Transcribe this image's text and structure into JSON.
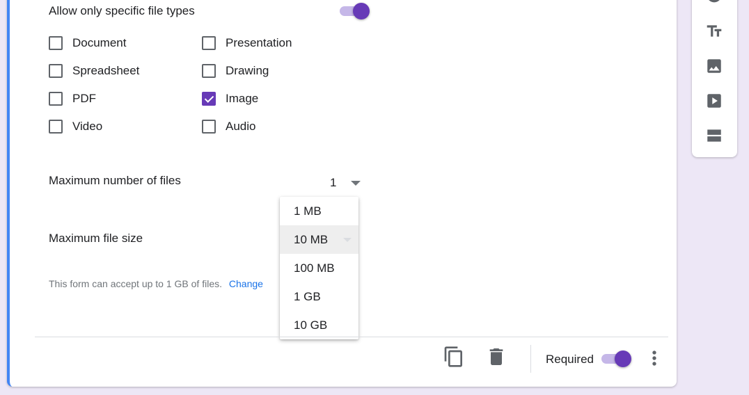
{
  "file_types": {
    "restrict_label": "Allow only specific file types",
    "restrict_enabled": true,
    "options": [
      {
        "label": "Document",
        "checked": false
      },
      {
        "label": "Presentation",
        "checked": false
      },
      {
        "label": "Spreadsheet",
        "checked": false
      },
      {
        "label": "Drawing",
        "checked": false
      },
      {
        "label": "PDF",
        "checked": false
      },
      {
        "label": "Image",
        "checked": true
      },
      {
        "label": "Video",
        "checked": false
      },
      {
        "label": "Audio",
        "checked": false
      }
    ]
  },
  "max_files": {
    "label": "Maximum number of files",
    "value": "1"
  },
  "max_size": {
    "label": "Maximum file size",
    "options": [
      "1 MB",
      "10 MB",
      "100 MB",
      "1 GB",
      "10 GB"
    ],
    "selected": "10 MB"
  },
  "capacity_hint": {
    "text": "This form can accept up to 1 GB of files.",
    "link": "Change"
  },
  "footer": {
    "required_label": "Required",
    "required_enabled": true
  },
  "toolbar": {
    "icons": [
      "add-question-icon",
      "title-text-icon",
      "image-icon",
      "video-icon",
      "section-icon"
    ]
  },
  "colors": {
    "accent": "#673ab7",
    "accent_light": "#c5b7e8",
    "background": "#ede7f6",
    "focus_bar": "#4285f4",
    "link": "#1a73e8"
  }
}
